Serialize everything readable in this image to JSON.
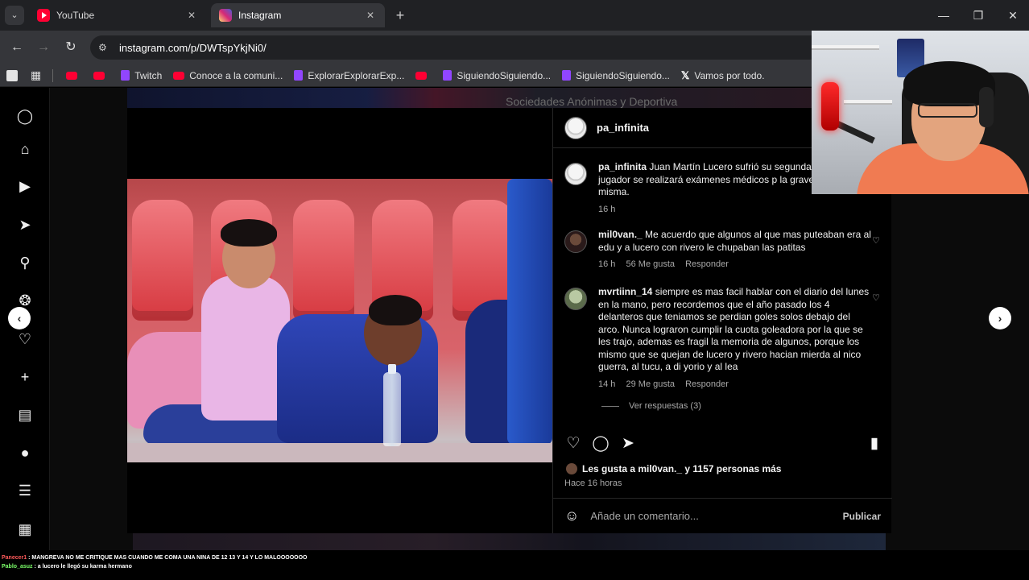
{
  "browser": {
    "tabs": [
      {
        "title": "YouTube",
        "active": false
      },
      {
        "title": "Instagram",
        "active": true
      }
    ],
    "url": "instagram.com/p/DWTspYkjNi0/",
    "bookmarks": [
      {
        "label": "",
        "icon": "youtube-icon"
      },
      {
        "label": "",
        "icon": "youtube-icon"
      },
      {
        "label": "Twitch",
        "icon": "twitch-icon"
      },
      {
        "label": "Conoce a la comuni...",
        "icon": "youtube-icon"
      },
      {
        "label": "ExplorarExplorarExp...",
        "icon": "twitch-icon"
      },
      {
        "label": "",
        "icon": "youtube-icon"
      },
      {
        "label": "SiguiendoSiguiendo...",
        "icon": "twitch-icon"
      },
      {
        "label": "SiguiendoSiguiendo...",
        "icon": "twitch-icon"
      },
      {
        "label": "Vamos por todo.",
        "icon": "x-icon"
      }
    ]
  },
  "background": {
    "top_text": "Sociedades Anónimas y Deportiva"
  },
  "post": {
    "username": "pa_infinita",
    "caption_user": "pa_infinita",
    "caption_text": "Juan Martín Lucero sufrió su segunda le llegada, el jugador se realizará exámenes médicos p la gravedad de la misma.",
    "caption_time": "16 h",
    "comments": [
      {
        "user": "mil0van._",
        "text": "Me acuerdo que algunos al que mas puteaban era al edu y a lucero con rivero le chupaban las patitas",
        "time": "16 h",
        "likes": "56 Me gusta",
        "reply": "Responder"
      },
      {
        "user": "mvrtiinn_14",
        "text": "siempre es mas facil hablar con el diario del lunes en la mano, pero recordemos que el año pasado los 4 delanteros que teniamos se perdian goles solos debajo del arco. Nunca lograron cumplir la cuota goleadora por la que se les trajo, ademas es fragil la memoria de algunos, porque los mismo que se quejan de lucero y rivero hacian mierda al nico guerra, al tucu, a di yorio y al lea",
        "time": "14 h",
        "likes": "29 Me gusta",
        "reply": "Responder"
      }
    ],
    "view_replies": "Ver respuestas (3)",
    "likes_text": "Les gusta a mil0van._ y 1157 personas más",
    "posted_time": "Hace 16 horas",
    "add_comment_placeholder": "Añade un comentario...",
    "publish_label": "Publicar"
  },
  "chat": {
    "lines": [
      {
        "user": "Panecer1",
        "text": ": MANGREVA NO ME CRITIQUE MAS CUANDO ME COMA UNA NINA DE 12 13 Y 14 Y LO MALOOOOOOO"
      },
      {
        "user": "Pablo_asuz",
        "text": ": a lucero le llegó su karma hermano"
      }
    ]
  },
  "colors": {
    "ig_bg": "#000000",
    "text_primary": "#f5f5f5",
    "text_secondary": "#a8a8a8"
  }
}
